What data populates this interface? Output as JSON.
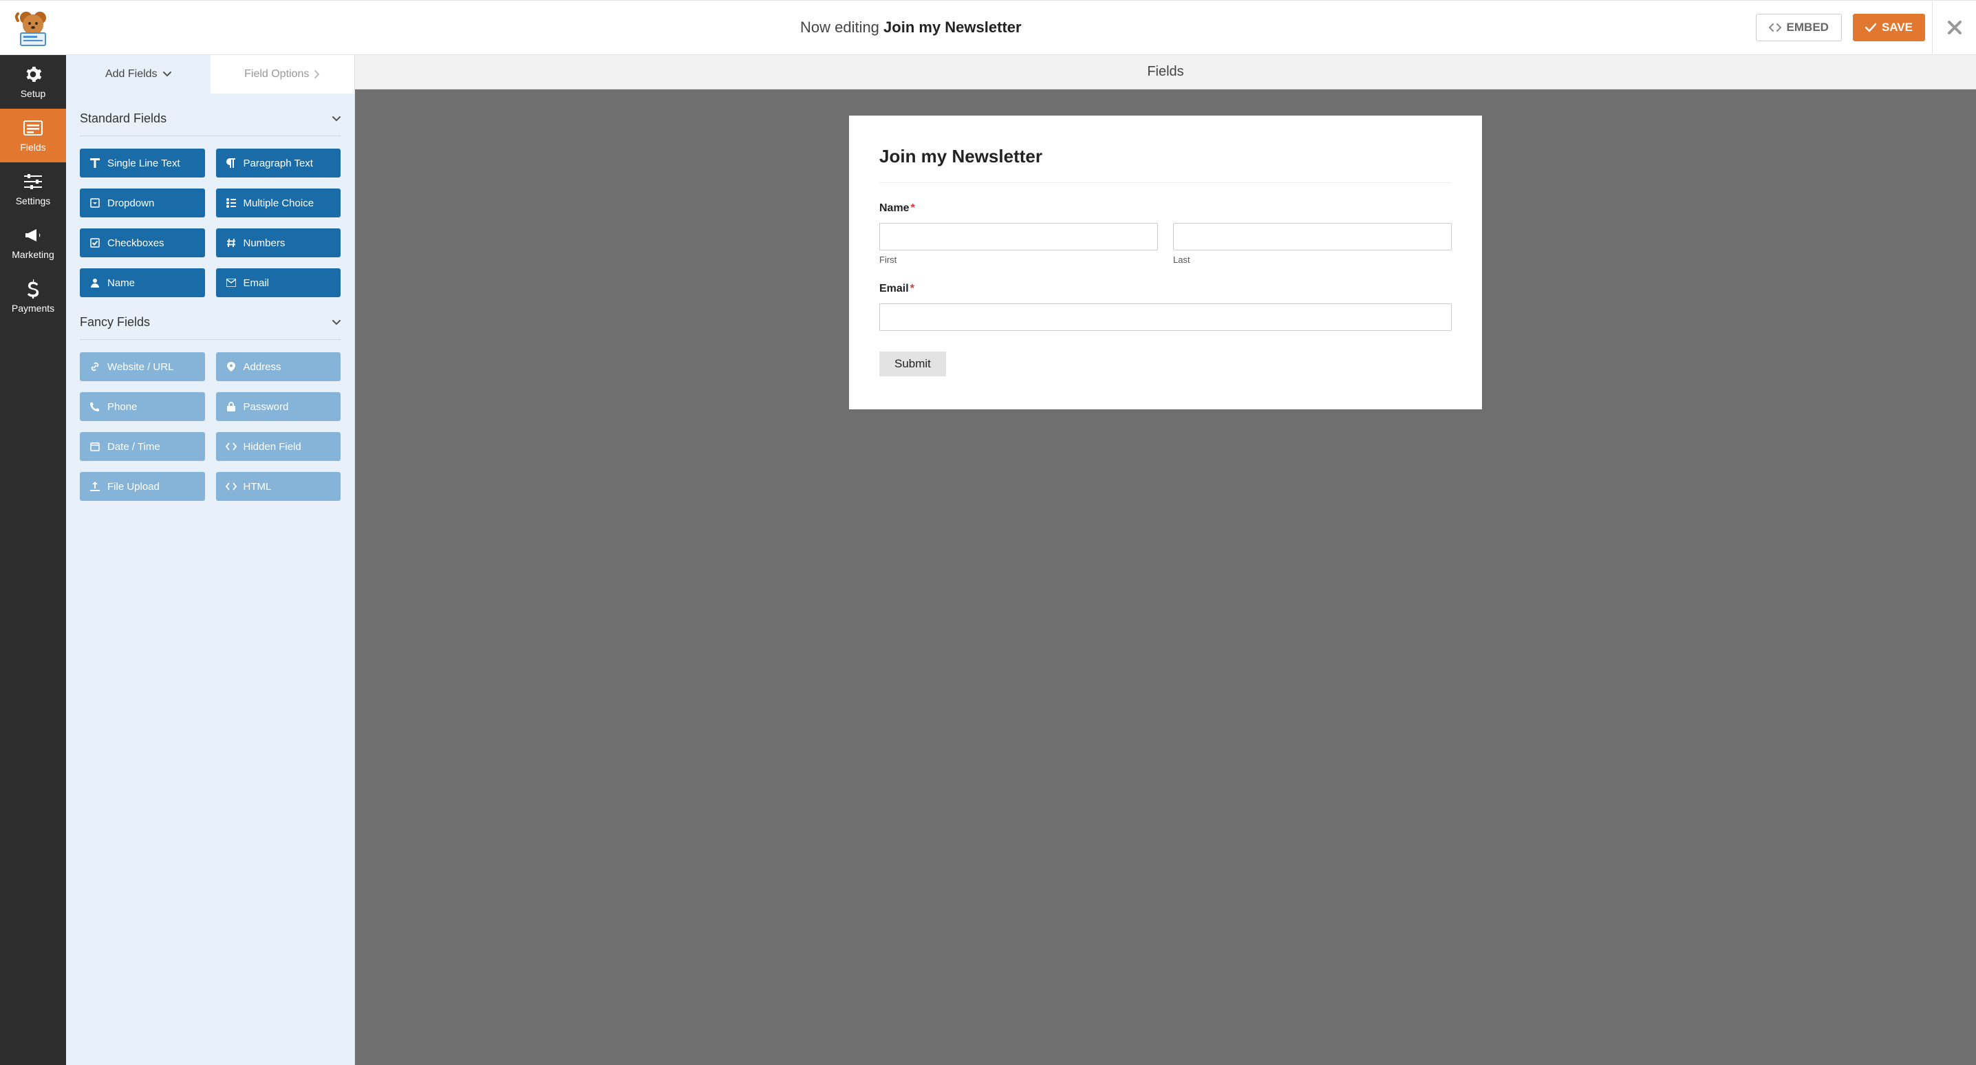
{
  "header": {
    "editing_prefix": "Now editing",
    "form_name": "Join my Newsletter",
    "embed_label": "EMBED",
    "save_label": "SAVE"
  },
  "leftnav": {
    "items": [
      {
        "key": "setup",
        "label": "Setup"
      },
      {
        "key": "fields",
        "label": "Fields"
      },
      {
        "key": "settings",
        "label": "Settings"
      },
      {
        "key": "marketing",
        "label": "Marketing"
      },
      {
        "key": "payments",
        "label": "Payments"
      }
    ],
    "active": "fields"
  },
  "panel": {
    "tabs": {
      "add_fields": "Add Fields",
      "field_options": "Field Options"
    },
    "sections": {
      "standard": {
        "title": "Standard Fields",
        "fields": [
          "Single Line Text",
          "Paragraph Text",
          "Dropdown",
          "Multiple Choice",
          "Checkboxes",
          "Numbers",
          "Name",
          "Email"
        ]
      },
      "fancy": {
        "title": "Fancy Fields",
        "fields": [
          "Website / URL",
          "Address",
          "Phone",
          "Password",
          "Date / Time",
          "Hidden Field",
          "File Upload",
          "HTML"
        ]
      }
    }
  },
  "preview": {
    "heading": "Fields",
    "form_title": "Join my Newsletter",
    "name_label": "Name",
    "first_sub": "First",
    "last_sub": "Last",
    "email_label": "Email",
    "submit_label": "Submit"
  },
  "colors": {
    "accent": "#e27730",
    "blue": "#1a6ca8",
    "blue_muted": "#86b4d8"
  }
}
